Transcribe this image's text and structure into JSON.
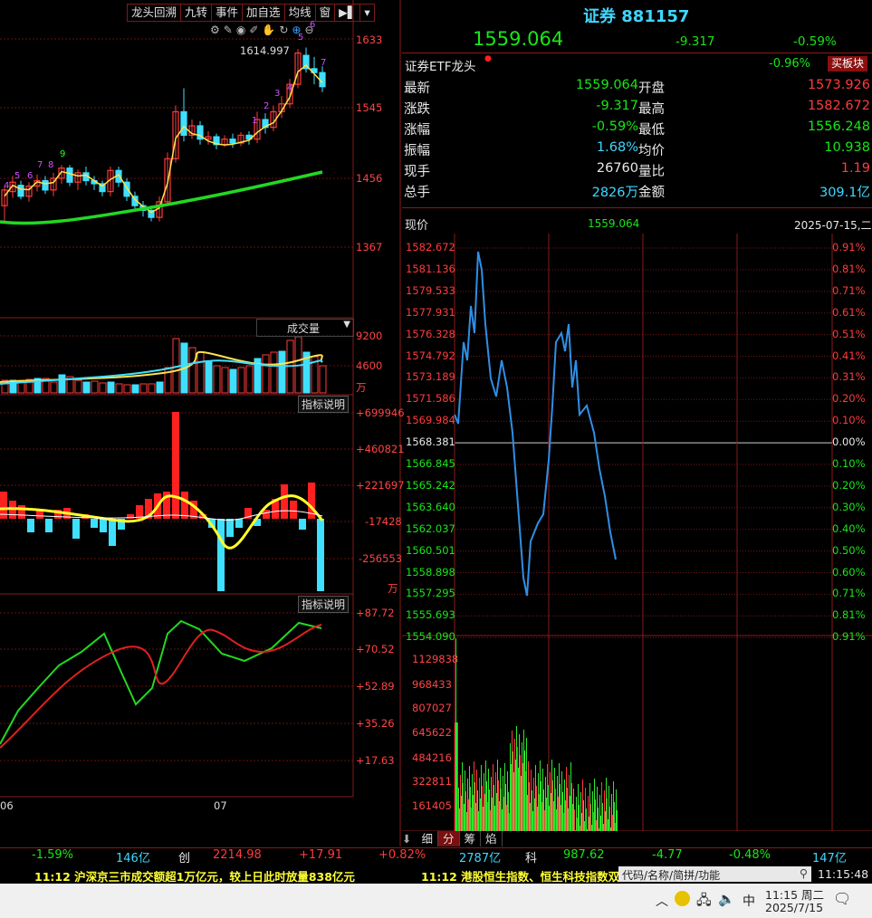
{
  "toolbar": {
    "items": [
      "龙头回溯",
      "九转",
      "事件",
      "加自选",
      "均线",
      "窗",
      "▶▌",
      "▾"
    ]
  },
  "kline": {
    "price_axis": [
      "1633",
      "1545",
      "1456",
      "1367"
    ],
    "peak_label": "1614.997",
    "nine_turn_marks": [
      "4",
      "5",
      "6",
      "7",
      "8",
      "9",
      "1",
      "2",
      "3",
      "4",
      "5",
      "6",
      "7"
    ],
    "month_labels": [
      "06",
      "07"
    ]
  },
  "volume": {
    "title": "成交量",
    "axis": [
      "9200",
      "4600"
    ],
    "unit": "万"
  },
  "indicator1": {
    "button": "指标说明",
    "axis": [
      "+699946",
      "+460821",
      "+221697",
      "-17428",
      "-256553"
    ],
    "unit": "万"
  },
  "indicator2": {
    "button": "指标说明",
    "axis": [
      "+87.72",
      "+70.52",
      "+52.89",
      "+35.26",
      "+17.63"
    ]
  },
  "quote": {
    "name": "证券",
    "code": "881157",
    "price": "1559.064",
    "change": "-9.317",
    "change_pct": "-0.59%",
    "etf_label": "证券ETF龙头",
    "etf_pct": "-0.96%",
    "buy_block": "买板块",
    "rows": [
      {
        "l1": "最新",
        "v1": "1559.064",
        "l2": "开盘",
        "v2": "1573.926"
      },
      {
        "l1": "涨跌",
        "v1": "-9.317",
        "l2": "最高",
        "v2": "1582.672"
      },
      {
        "l1": "涨幅",
        "v1": "-0.59%",
        "l2": "最低",
        "v2": "1556.248"
      },
      {
        "l1": "振幅",
        "v1": "1.68%",
        "l2": "均价",
        "v2": "10.938"
      },
      {
        "l1": "现手",
        "v1": "26760",
        "l2": "量比",
        "v2": "1.19"
      },
      {
        "l1": "总手",
        "v1": "2826万",
        "l2": "金额",
        "v2": "309.1亿"
      }
    ]
  },
  "intraday": {
    "label_now": "现价",
    "now_value": "1559.064",
    "date": "2025-07-15,二",
    "price_ticks": [
      "1582.672",
      "1581.136",
      "1579.533",
      "1577.931",
      "1576.328",
      "1574.792",
      "1573.189",
      "1571.586",
      "1569.984",
      "1568.381",
      "1566.845",
      "1565.242",
      "1563.640",
      "1562.037",
      "1560.501",
      "1558.898",
      "1557.295",
      "1555.693",
      "1554.090"
    ],
    "pct_ticks": [
      "0.91%",
      "0.81%",
      "0.71%",
      "0.61%",
      "0.51%",
      "0.41%",
      "0.31%",
      "0.20%",
      "0.10%",
      "0.00%",
      "0.10%",
      "0.20%",
      "0.30%",
      "0.40%",
      "0.50%",
      "0.60%",
      "0.71%",
      "0.81%",
      "0.91%"
    ],
    "vol_ticks": [
      "1129838",
      "968433",
      "807027",
      "645622",
      "484216",
      "322811",
      "161405"
    ]
  },
  "tabs": [
    "细",
    "分",
    "筹",
    "焰"
  ],
  "status": {
    "pct1": "-1.59%",
    "amt1": "146亿",
    "board2": "创",
    "idx2": "2214.98",
    "chg2": "+17.91",
    "pct2": "+0.82%",
    "amt2": "2787亿",
    "board3": "科",
    "idx3": "987.62",
    "chg3": "-4.77",
    "pct3": "-0.48%",
    "amt3": "147亿"
  },
  "news": {
    "item1": "11:12 沪深京三市成交额超1万亿元，较上日此时放量838亿元",
    "item2": "11:12 港股恒生指数、恒生科技指数双",
    "search_placeholder": "代码/名称/简拼/功能",
    "clock": "11:15:48"
  },
  "taskbar": {
    "ime": "中",
    "time": "11:15 周二",
    "date": "2025/7/15"
  },
  "colors": {
    "up": "#ff3b3b",
    "down": "#19e619",
    "price_line": "#2f8fe6",
    "grid": "#7a1414"
  }
}
